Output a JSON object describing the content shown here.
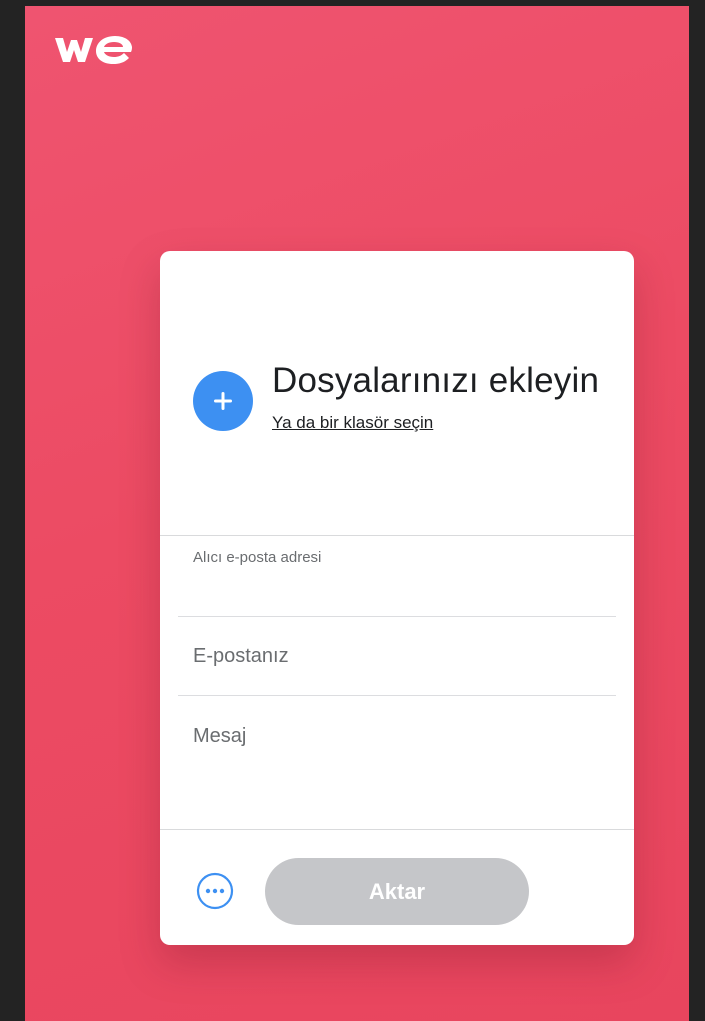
{
  "brand": {
    "logo_text": "we",
    "logo_color": "#ffffff",
    "background": "#ec4b63"
  },
  "upload": {
    "title": "Dosyalarınızı ekleyin",
    "folder_link": "Ya da bir klasör seçin",
    "icon": "plus-icon",
    "accent_color": "#3d90f2"
  },
  "form": {
    "recipient_label": "Alıcı e-posta adresi",
    "recipient_value": "",
    "sender_placeholder": "E-postanız",
    "sender_value": "",
    "message_placeholder": "Mesaj",
    "message_value": ""
  },
  "footer": {
    "options_icon": "more-options-icon",
    "send_label": "Aktar",
    "send_color": "#c5c6c9"
  }
}
